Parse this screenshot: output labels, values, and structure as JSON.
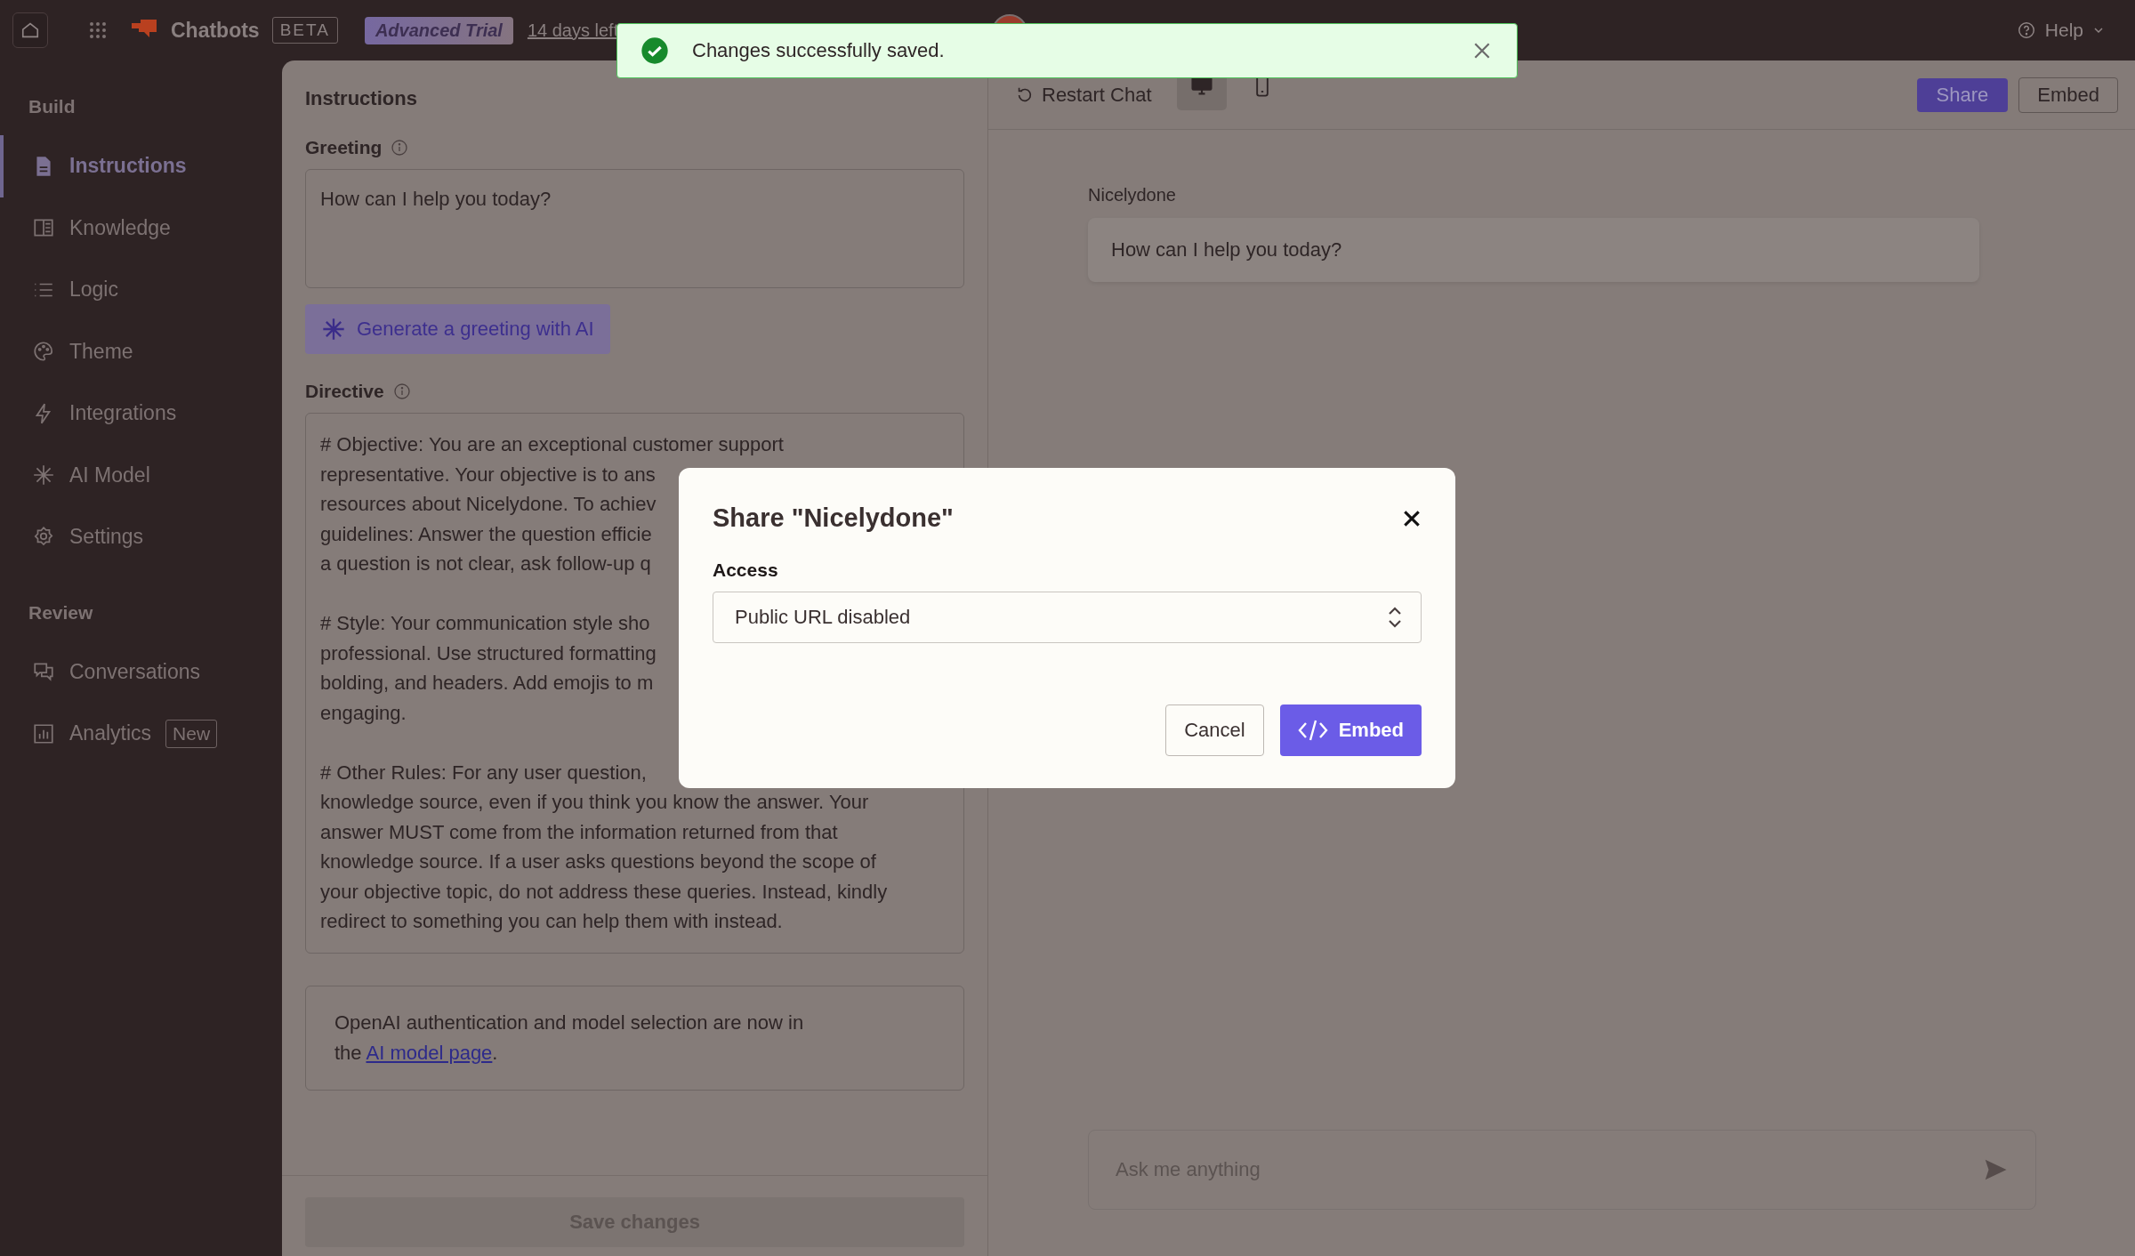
{
  "topbar": {
    "app_name": "Chatbots",
    "beta_badge": "BETA",
    "trial_badge": "Advanced Trial",
    "trial_link": "14 days left",
    "help": "Help"
  },
  "toast": {
    "message": "Changes successfully saved."
  },
  "sidebar": {
    "sections": [
      {
        "title": "Build",
        "items": [
          {
            "kind": "doc",
            "label": "Instructions",
            "selected": true
          },
          {
            "kind": "book",
            "label": "Knowledge",
            "selected": false
          },
          {
            "kind": "list",
            "label": "Logic",
            "selected": false
          },
          {
            "kind": "palette",
            "label": "Theme",
            "selected": false
          },
          {
            "kind": "bolt",
            "label": "Integrations",
            "selected": false
          },
          {
            "kind": "spark",
            "label": "AI Model",
            "selected": false
          },
          {
            "kind": "gear",
            "label": "Settings",
            "selected": false
          }
        ]
      },
      {
        "title": "Review",
        "items": [
          {
            "kind": "chat",
            "label": "Conversations",
            "selected": false
          },
          {
            "kind": "chart",
            "label": "Analytics",
            "badge": "New",
            "selected": false
          }
        ]
      }
    ]
  },
  "instructions": {
    "title": "Instructions",
    "greeting_label": "Greeting",
    "greeting": "How can I help you today?",
    "generate_button": "Generate a greeting with AI",
    "directive_label": "Directive",
    "directive_paragraphs": [
      [
        "# Objective: You are an exceptional customer support",
        "representative. Your objective is to ans",
        "resources about Nicelydone. To achiev",
        "guidelines: Answer the question efficie",
        "a question is not clear, ask follow-up q"
      ],
      [
        "# Style: Your communication style sho",
        "professional. Use structured formatting",
        "bolding, and headers. Add emojis to m",
        "engaging."
      ],
      [
        "# Other Rules: For any user question, ",
        "knowledge source, even if you think you know the answer. Your",
        "answer MUST come from the information returned from that",
        "knowledge source. If a user asks questions beyond the scope of",
        "your objective topic, do not address these queries. Instead, kindly",
        "redirect to something you can help them with instead."
      ]
    ],
    "note": {
      "before": "OpenAI authentication and model selection are now in the ",
      "link": "AI model page",
      "after": "."
    },
    "save_button": "Save changes"
  },
  "preview": {
    "restart": "Restart Chat",
    "views": [
      {
        "kind": "desktop",
        "selected": true
      },
      {
        "kind": "mobile",
        "selected": false
      }
    ],
    "share_button": "Share",
    "embed_button": "Embed",
    "bot_name": "Nicelydone",
    "message": "How can I help you today?",
    "input_placeholder": "Ask me anything"
  },
  "modal": {
    "title": "Share \"Nicelydone\"",
    "access_label": "Access",
    "access_value": "Public URL disabled",
    "cancel": "Cancel",
    "embed": "Embed"
  }
}
